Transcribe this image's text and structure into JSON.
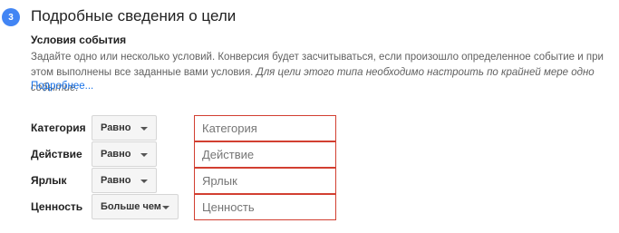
{
  "step": {
    "number": "3",
    "title": "Подробные сведения о цели"
  },
  "section": {
    "subtitle": "Условия события",
    "description_part1": "Задайте одно или несколько условий. Конверсия будет засчитываться, если произошло определенное событие и при этом выполнены все заданные вами условия.",
    "description_part2": "Для цели этого типа необходимо настроить по крайней мере одно событие.",
    "more_link": "Подробнее..."
  },
  "conditions": [
    {
      "label": "Категория",
      "operator": "Равно",
      "placeholder": "Категория"
    },
    {
      "label": "Действие",
      "operator": "Равно",
      "placeholder": "Действие"
    },
    {
      "label": "Ярлык",
      "operator": "Равно",
      "placeholder": "Ярлык"
    },
    {
      "label": "Ценность",
      "operator": "Больше чем",
      "placeholder": "Ценность"
    }
  ],
  "colors": {
    "accent": "#4285f4",
    "error_border": "#d23f31",
    "link": "#1a73e8"
  }
}
